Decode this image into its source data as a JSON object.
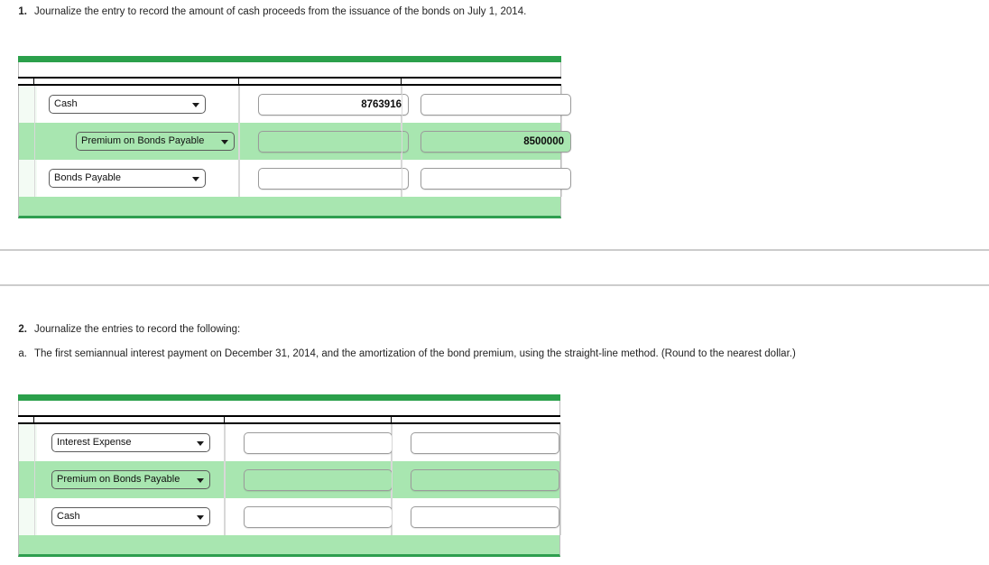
{
  "questions": [
    {
      "number": "1.",
      "text": "Journalize the entry to record the amount of cash proceeds from the issuance of the bonds on July 1, 2014."
    },
    {
      "number": "2.",
      "text": "Journalize the entries to record the following:"
    },
    {
      "number": "a.",
      "text": "The first semiannual interest payment on December 31, 2014, and the amortization of the bond premium, using the straight-line method. (Round to the nearest dollar.)"
    }
  ],
  "colors": {
    "header_green": "#2ba04b",
    "row_highlight_green": "#a8e6b0",
    "footer_green": "#a8e6b0",
    "footer_rule_green": "#2e9e4f",
    "divider_gray": "#cccccc"
  },
  "tables": [
    {
      "id": "journal-entry-1",
      "rows": [
        {
          "account": "Cash",
          "account_placeholder": "",
          "debit": "8763916",
          "credit": "",
          "highlight": false,
          "indent": false
        },
        {
          "account": "Premium on Bonds Payable",
          "account_placeholder": "",
          "debit": "",
          "credit": "8500000",
          "highlight": true,
          "indent": true
        },
        {
          "account": "Bonds Payable",
          "account_placeholder": "",
          "debit": "",
          "credit": "",
          "highlight": false,
          "indent": false
        }
      ]
    },
    {
      "id": "journal-entry-2a",
      "rows": [
        {
          "account": "Interest Expense",
          "account_placeholder": "",
          "debit": "",
          "credit": "",
          "highlight": false,
          "indent": false
        },
        {
          "account": "Premium on Bonds Payable",
          "account_placeholder": "",
          "debit": "",
          "credit": "",
          "highlight": true,
          "indent": false
        },
        {
          "account": "Cash",
          "account_placeholder": "",
          "debit": "",
          "credit": "",
          "highlight": false,
          "indent": false
        }
      ]
    }
  ]
}
